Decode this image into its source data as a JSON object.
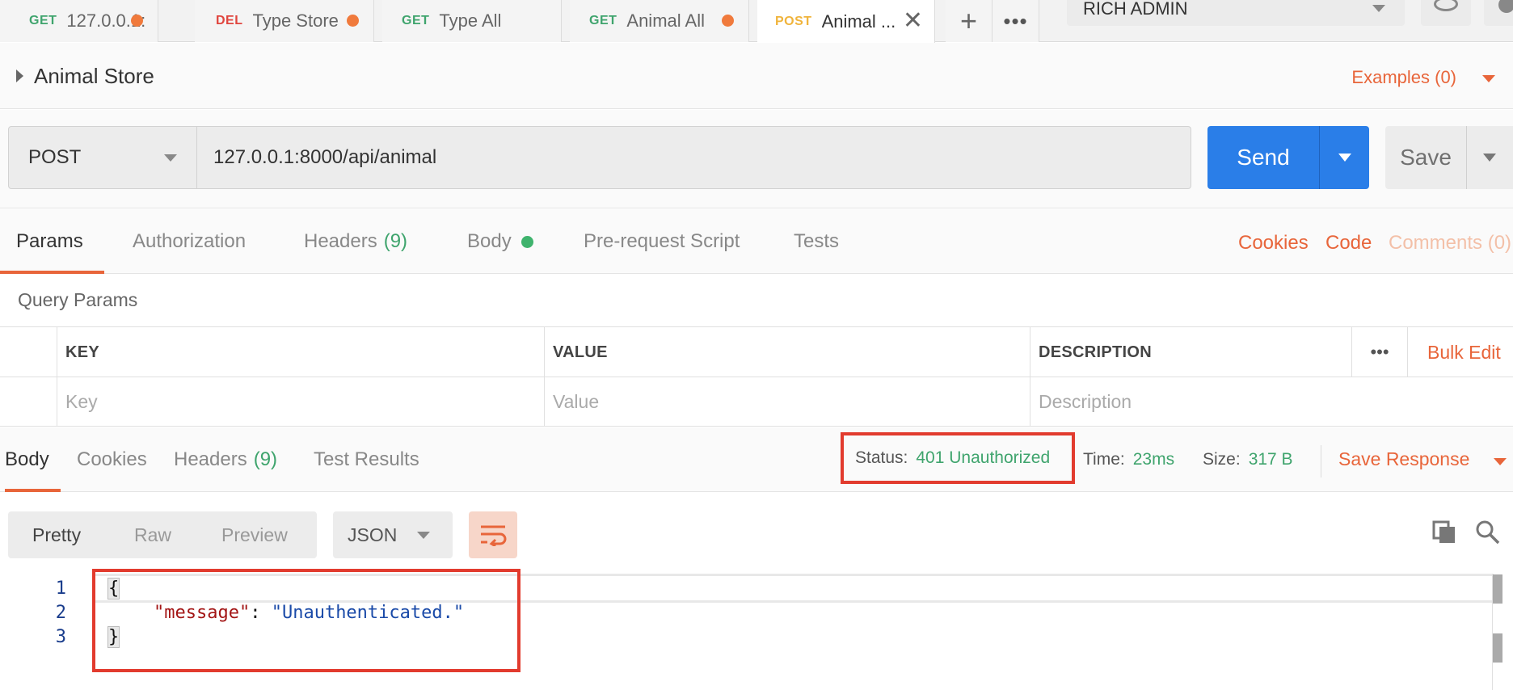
{
  "tabs": [
    {
      "method": "GET",
      "name": "127.0.0.1:...",
      "modified": true
    },
    {
      "method": "DEL",
      "name": "Type Store",
      "modified": true
    },
    {
      "method": "GET",
      "name": "Type All",
      "modified": false
    },
    {
      "method": "GET",
      "name": "Animal All",
      "modified": true
    },
    {
      "method": "POST",
      "name": "Animal ...",
      "active": true
    }
  ],
  "tabbar": {
    "add_label": "+",
    "more_label": "•••"
  },
  "environment": {
    "selected": "RICH ADMIN"
  },
  "request": {
    "name": "Animal Store",
    "examples_label": "Examples (0)",
    "method": "POST",
    "url": "127.0.0.1:8000/api/animal",
    "send_label": "Send",
    "save_label": "Save"
  },
  "request_tabs": {
    "params": "Params",
    "authorization": "Authorization",
    "headers": "Headers",
    "headers_count": "(9)",
    "body": "Body",
    "prerequest": "Pre-request Script",
    "tests": "Tests",
    "cookies": "Cookies",
    "code": "Code",
    "comments": "Comments (0)"
  },
  "query_params": {
    "title": "Query Params",
    "columns": [
      "KEY",
      "VALUE",
      "DESCRIPTION"
    ],
    "placeholders": {
      "key": "Key",
      "value": "Value",
      "description": "Description"
    },
    "more_label": "•••",
    "bulk_edit_label": "Bulk Edit"
  },
  "response": {
    "tabs": {
      "body": "Body",
      "cookies": "Cookies",
      "headers": "Headers",
      "headers_count": "(9)",
      "test_results": "Test Results"
    },
    "status_label": "Status:",
    "status_value": "401 Unauthorized",
    "time_label": "Time:",
    "time_value": "23ms",
    "size_label": "Size:",
    "size_value": "317 B",
    "save_response_label": "Save Response",
    "views": [
      "Pretty",
      "Raw",
      "Preview"
    ],
    "format": "JSON",
    "lines": [
      "1",
      "2",
      "3"
    ],
    "code": {
      "open": "{",
      "key": "\"message\"",
      "colon": ": ",
      "value": "\"Unauthenticated.\"",
      "close": "}"
    }
  },
  "colors": {
    "accent": "#e8653a",
    "send": "#2a7ee8",
    "get": "#3fa46d",
    "del": "#e0453e",
    "post": "#f0b43c",
    "highlight_box": "#e23b2e"
  }
}
